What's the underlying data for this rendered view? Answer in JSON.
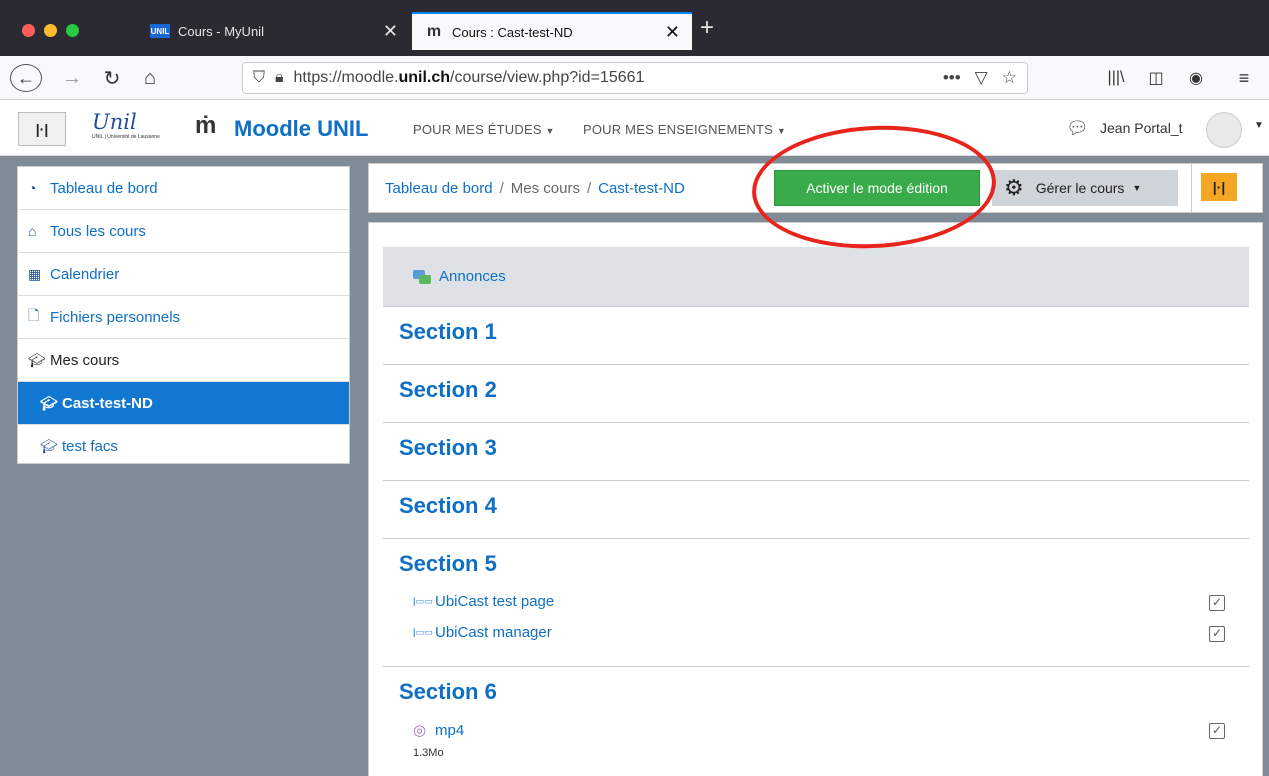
{
  "browser": {
    "tabs": [
      {
        "label": "Cours - MyUnil",
        "favicon": "UNIL"
      },
      {
        "label": "Cours : Cast-test-ND",
        "favicon": "m"
      }
    ],
    "url_prefix": "https://moodle.",
    "url_domain": "unil.ch",
    "url_path": "/course/view.php?id=15661"
  },
  "header": {
    "logo_script": "Unil",
    "logo_small": "UNIL | Université de Lausanne",
    "site_name": "Moodle UNIL",
    "menu1": "POUR MES ÉTUDES",
    "menu2": "POUR MES ENSEIGNEMENTS",
    "user_name": "Jean Portal_t"
  },
  "sidebar": {
    "items": [
      {
        "label": "Tableau de bord",
        "icon": "dashboard-icon"
      },
      {
        "label": "Tous les cours",
        "icon": "home-icon"
      },
      {
        "label": "Calendrier",
        "icon": "calendar-icon"
      },
      {
        "label": "Fichiers personnels",
        "icon": "file-icon"
      },
      {
        "label": "Mes cours",
        "icon": "graduation-cap-icon"
      },
      {
        "label": "Cast-test-ND",
        "icon": "graduation-cap-icon"
      },
      {
        "label": "test facs",
        "icon": "graduation-cap-icon"
      }
    ]
  },
  "breadcrumb": {
    "items": [
      "Tableau de bord",
      "Mes cours",
      "Cast-test-ND"
    ]
  },
  "actions": {
    "edit_mode": "Activer le mode édition",
    "manage_course": "Gérer le cours"
  },
  "course": {
    "announcements": "Annonces",
    "sections": [
      {
        "title": "Section 1"
      },
      {
        "title": "Section 2"
      },
      {
        "title": "Section 3"
      },
      {
        "title": "Section 4"
      },
      {
        "title": "Section 5",
        "activities": [
          "UbiCast test page",
          "UbiCast manager"
        ]
      },
      {
        "title": "Section 6",
        "activities": [
          "mp4"
        ],
        "meta": "1.3Mo"
      }
    ]
  },
  "colors": {
    "accent": "#0f6fc5",
    "edit_button": "#3aab4a",
    "annotation": "#e8251b",
    "block_toggle": "#f5a623"
  }
}
